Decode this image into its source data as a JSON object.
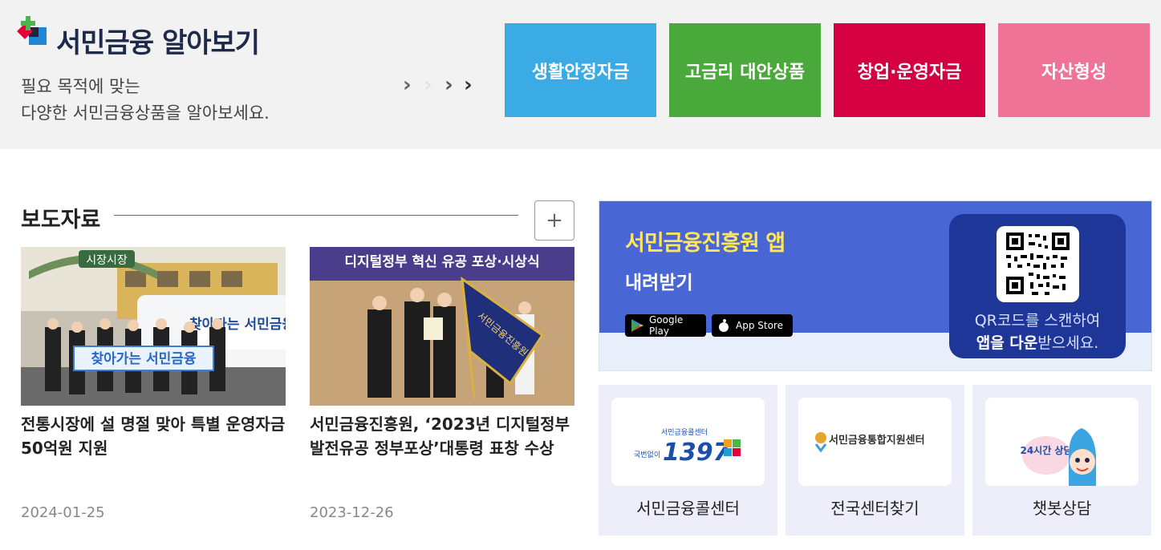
{
  "intro": {
    "title": "서민금융 알아보기",
    "desc_line1": "필요 목적에 맞는",
    "desc_line2": "다양한 서민금융상품을 알아보세요."
  },
  "categories": [
    {
      "label": "생활안정자금",
      "color": "#3aabe5"
    },
    {
      "label": "고금리 대안상품",
      "color": "#49a93b"
    },
    {
      "label": "창업·운영자금",
      "color": "#d40041"
    },
    {
      "label": "자산형성",
      "color": "#ee7397"
    }
  ],
  "news": {
    "section_title": "보도자료",
    "more_label": "+",
    "items": [
      {
        "title": "전통시장에 설 명절 맞아 특별 운영자금 50억원 지원",
        "date": "2024-01-25",
        "image_sign": "시장시장",
        "image_banner": "찾아가는 서민금융",
        "image_van_text": "찾아가는 서민금융"
      },
      {
        "title": "서민금융진흥원, ‘2023년 디지털정부 발전유공 정부포상’대통령 표창 수상",
        "date": "2023-12-26",
        "image_banner": "디지털정부 혁신 유공 포상·시상식",
        "image_flag_text": "서민금융진흥원"
      }
    ]
  },
  "app_banner": {
    "title": "서민금융진흥원 앱",
    "subtitle": "내려받기",
    "google_play": "Google Play",
    "app_store": "App Store",
    "qr_line1": "QR코드를 스캔하여",
    "qr_line2_bold": "앱을 다운",
    "qr_line2_rest": "받으세요."
  },
  "services": [
    {
      "label": "서민금융콜센터",
      "logo_top": "서민금융콜센터",
      "logo_number": "1397",
      "logo_small": "국번없이"
    },
    {
      "label": "전국센터찾기",
      "logo_text": "서민금융통합지원센터"
    },
    {
      "label": "챗봇상담",
      "logo_text": "24시간 상담"
    }
  ]
}
